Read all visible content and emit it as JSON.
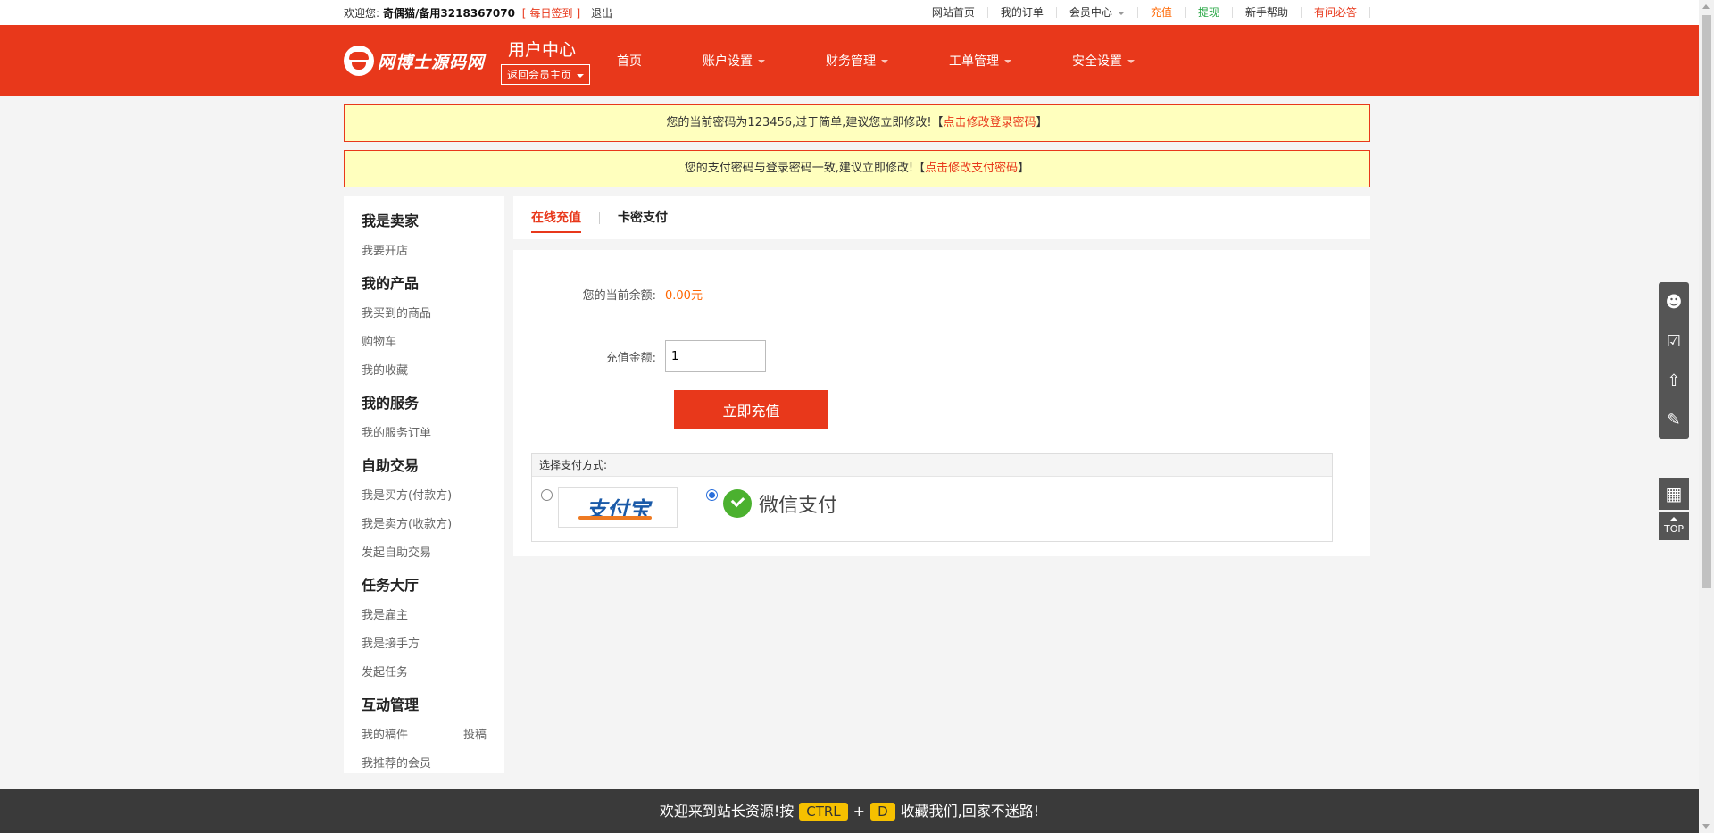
{
  "topbar": {
    "welcome": "欢迎您:",
    "username": "奇偶猫/备用3218367070",
    "sign_left": "[",
    "sign": "每日签到",
    "sign_right": "]",
    "logout": "退出",
    "links": {
      "home": "网站首页",
      "orders": "我的订单",
      "member": "会员中心",
      "recharge": "充值",
      "withdraw": "提现",
      "help": "新手帮助",
      "faq": "有问必答"
    }
  },
  "header": {
    "logo_text": "网博士源码网",
    "uc_title": "用户中心",
    "uc_back": "返回会员主页",
    "nav": {
      "home": "首页",
      "account": "账户设置",
      "finance": "财务管理",
      "ticket": "工单管理",
      "security": "安全设置"
    }
  },
  "alerts": {
    "a1_text": "您的当前密码为123456,过于简单,建议您立即修改!【",
    "a1_link": "点击修改登录密码",
    "a1_end": "】",
    "a2_text": "您的支付密码与登录密码一致,建议立即修改!【",
    "a2_link": "点击修改支付密码",
    "a2_end": "】"
  },
  "sidebar": {
    "g1": "我是卖家",
    "g1_i1": "我要开店",
    "g2": "我的产品",
    "g2_i1": "我买到的商品",
    "g2_i2": "购物车",
    "g2_i3": "我的收藏",
    "g3": "我的服务",
    "g3_i1": "我的服务订单",
    "g4": "自助交易",
    "g4_i1": "我是买方(付款方)",
    "g4_i2": "我是卖方(收款方)",
    "g4_i3": "发起自助交易",
    "g5": "任务大厅",
    "g5_i1": "我是雇主",
    "g5_i2": "我是接手方",
    "g5_i3": "发起任务",
    "g6": "互动管理",
    "g6_i1": "我的稿件",
    "g6_i1b": "投稿",
    "g6_i2": "我推荐的会员"
  },
  "tabs": {
    "online": "在线充值",
    "card": "卡密支付"
  },
  "form": {
    "balance_label": "您的当前余额:",
    "balance_value": "0.00元",
    "amount_label": "充值金额:",
    "amount_value": "1",
    "submit": "立即充值",
    "pay_title": "选择支付方式:",
    "alipay": "支付宝",
    "wechat": "微信支付",
    "selected": "wechat"
  },
  "float": {
    "top": "TOP"
  },
  "footer": {
    "text1": "欢迎来到站长资源!按",
    "key1": "CTRL",
    "plus": "+",
    "key2": "D",
    "text2": "收藏我们,回家不迷路!"
  },
  "colors": {
    "brand": "#e8381b",
    "notice_bg": "#ffffbe",
    "balance": "#ff6600",
    "wechat": "#4bb12f",
    "alipay": "#1a5aa8"
  }
}
